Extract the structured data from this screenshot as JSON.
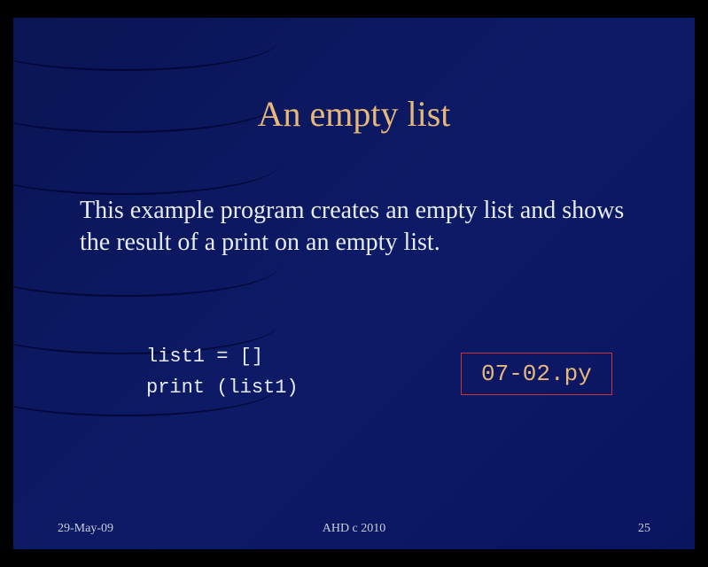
{
  "slide": {
    "title": "An empty list",
    "body_text": "This example program creates an empty list and shows the result of a print on an empty list.",
    "code_line1": "list1 = []",
    "code_line2": "print (list1)",
    "filename": "07-02.py"
  },
  "footer": {
    "date": "29-May-09",
    "copyright": "AHD  c  2010",
    "page_number": "25"
  }
}
